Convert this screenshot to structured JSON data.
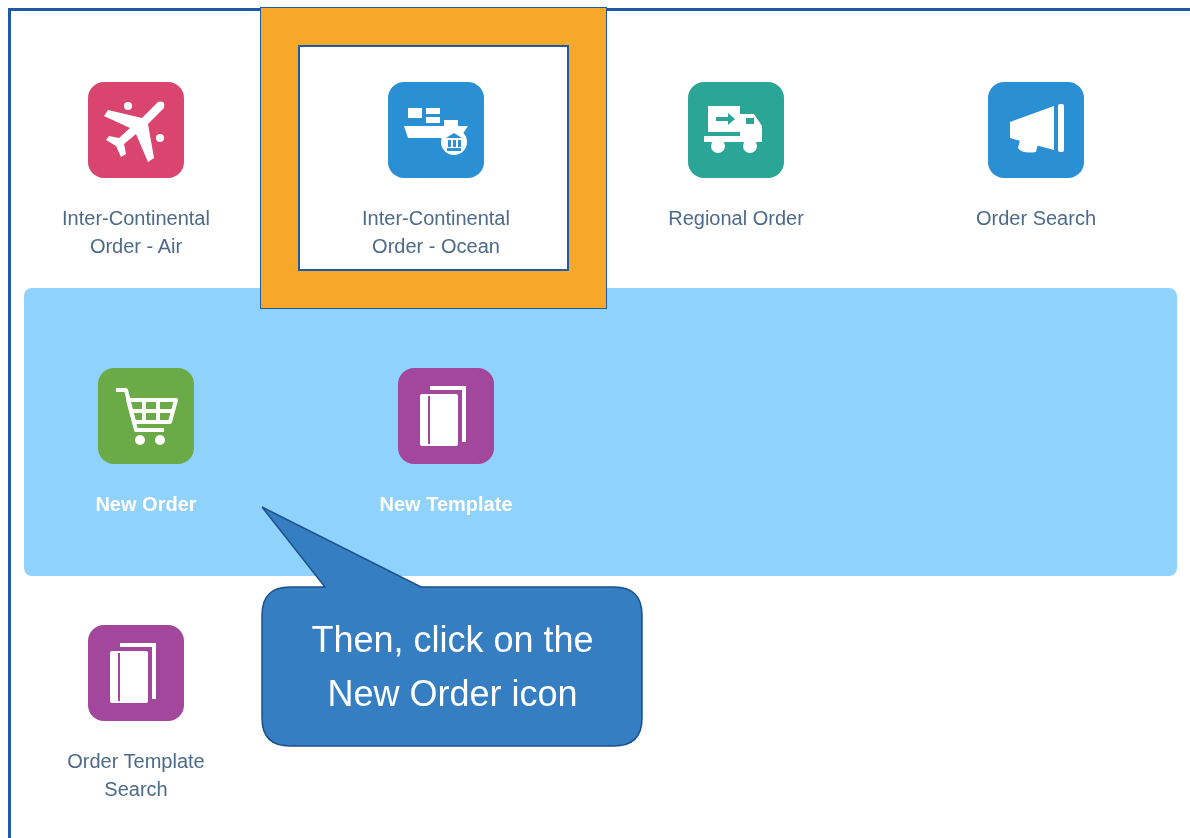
{
  "tiles": [
    {
      "label": "Inter-Continental Order - Air",
      "kind": "plane",
      "color": "#d9456f",
      "highlighted": false
    },
    {
      "label": "Inter-Continental Order - Ocean",
      "kind": "ship",
      "color": "#2b8fd4",
      "highlighted": true
    },
    {
      "label": "Regional Order",
      "kind": "truck",
      "color": "#2aa596",
      "highlighted": false
    },
    {
      "label": "Order Search",
      "kind": "megaphone",
      "color": "#2b8fd4",
      "highlighted": false
    }
  ],
  "submenu": {
    "tiles": [
      {
        "label": "New Order",
        "kind": "cart",
        "color": "#6aab48"
      },
      {
        "label": "New Template",
        "kind": "pages",
        "color": "#a2479c"
      }
    ]
  },
  "more_tiles": [
    {
      "label": "Order Template Search",
      "kind": "pages",
      "color": "#a2479c"
    }
  ],
  "callout": {
    "text": "Then, click on the New Order icon"
  }
}
